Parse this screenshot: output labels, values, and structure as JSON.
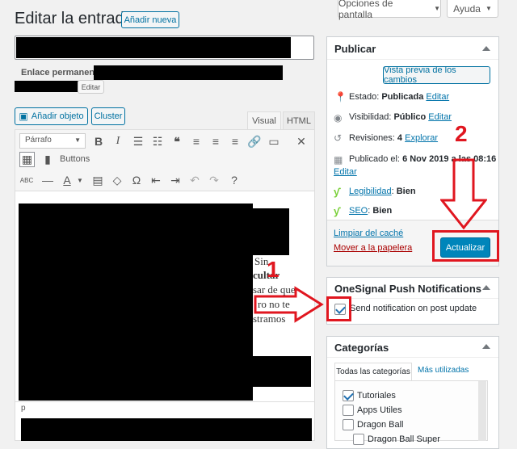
{
  "header": {
    "title": "Editar la entrada",
    "add_new": "Añadir nueva",
    "screen_options": "Opciones de pantalla",
    "help": "Ayuda"
  },
  "permalink": {
    "label": "Enlace permanente:",
    "edit": "Editar"
  },
  "editor": {
    "add_media": "Añadir objeto",
    "cluster": "Cluster",
    "tab_visual": "Visual",
    "tab_html": "HTML",
    "format_select": "Párrafo",
    "buttons_label": "Buttons",
    "path": "p",
    "visible_text": {
      "line1": "Sin",
      "line2": "cultar",
      "line3": "sar de que",
      "line4": "ro no te",
      "line5": "stramos"
    },
    "icons": [
      "bold-icon",
      "italic-icon",
      "bullet-list-icon",
      "numbered-list-icon",
      "blockquote-icon",
      "align-left-icon",
      "align-center-icon",
      "align-right-icon",
      "link-icon",
      "read-more-icon",
      "fullscreen-icon"
    ]
  },
  "publish": {
    "title": "Publicar",
    "preview": "Vista previa de los cambios",
    "status_label": "Estado:",
    "status_value": "Publicada",
    "visibility_label": "Visibilidad:",
    "visibility_value": "Público",
    "revisions_label": "Revisiones:",
    "revisions_value": "4",
    "explore": "Explorar",
    "published_label": "Publicado el:",
    "published_value": "6 Nov 2019 a las 08:16",
    "edit": "Editar",
    "readability_label": "Legibilidad",
    "readability_value": "Bien",
    "seo_label": "SEO",
    "seo_value": "Bien",
    "clear_cache": "Limpiar del caché",
    "trash": "Mover a la papelera",
    "update": "Actualizar"
  },
  "onesignal": {
    "title": "OneSignal Push Notifications",
    "checkbox_label": "Send notification on post update"
  },
  "categories": {
    "title": "Categorías",
    "tab_all": "Todas las categorías",
    "tab_most_used": "Más utilizadas",
    "items": [
      {
        "label": "Tutoriales",
        "checked": true
      },
      {
        "label": "Apps Utiles",
        "checked": false
      },
      {
        "label": "Dragon Ball",
        "checked": false
      },
      {
        "label": "Dragon Ball Super",
        "checked": false
      }
    ]
  },
  "annotations": {
    "one": "1",
    "two": "2",
    "color": "#e0161f"
  }
}
